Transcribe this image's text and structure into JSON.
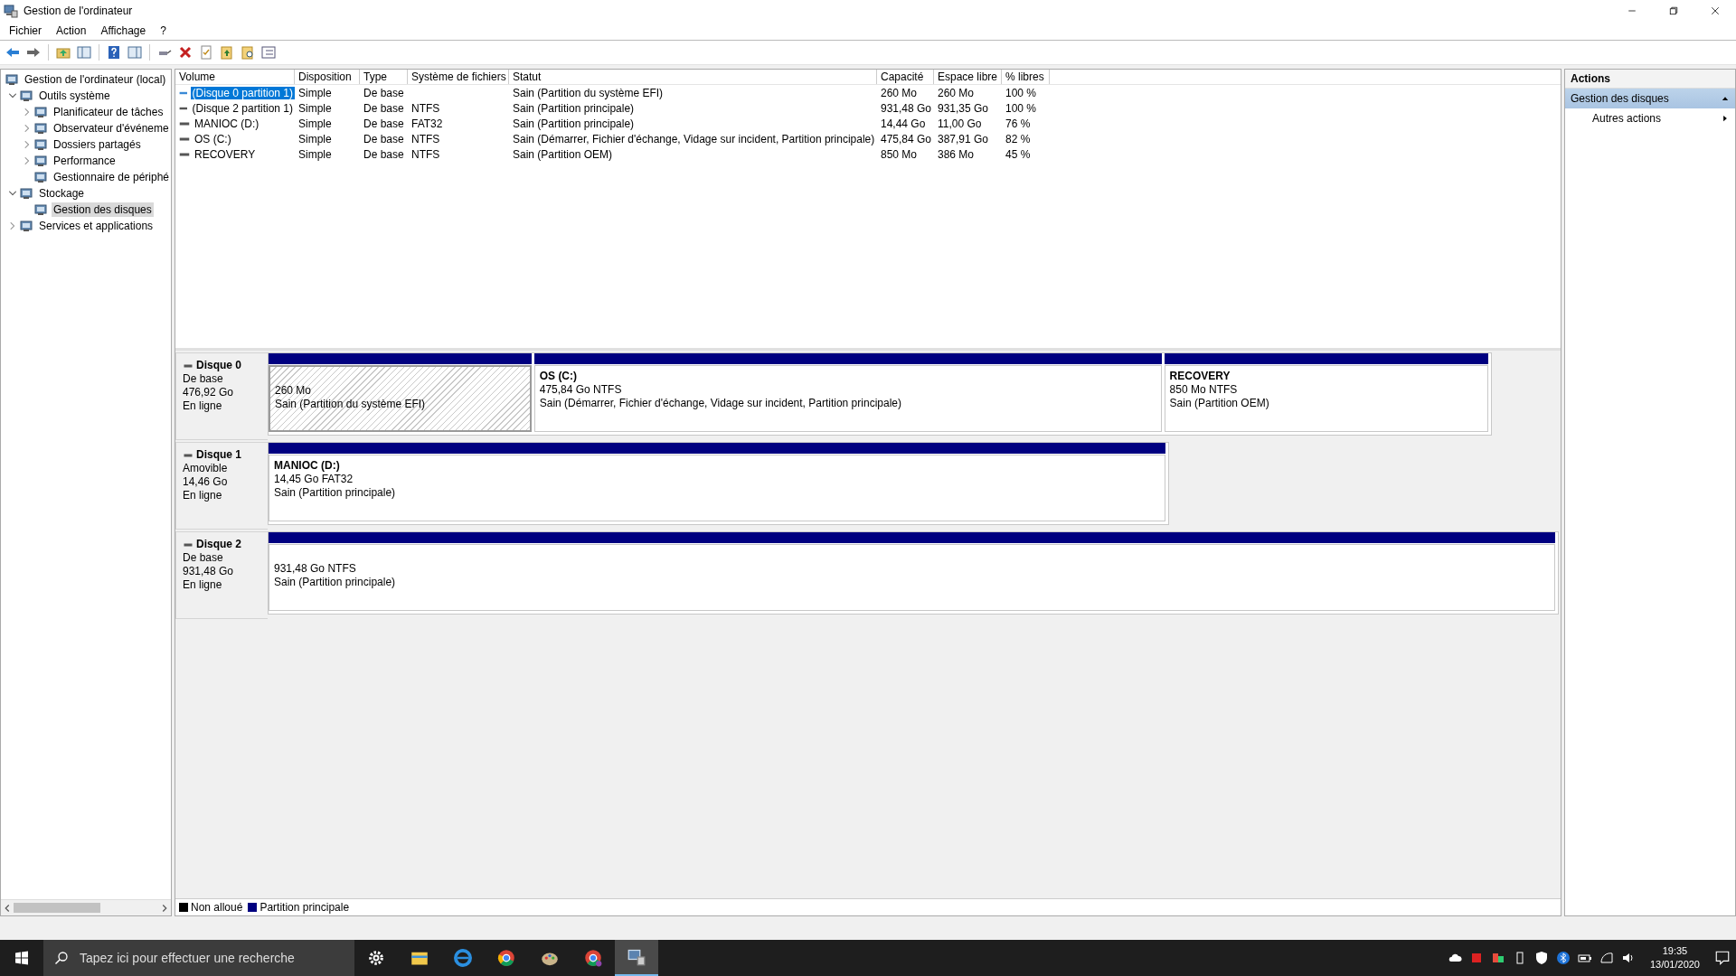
{
  "window": {
    "title": "Gestion de l'ordinateur"
  },
  "menu": [
    "Fichier",
    "Action",
    "Affichage",
    "?"
  ],
  "tree": [
    {
      "label": "Gestion de l'ordinateur (local)",
      "selected": false,
      "children": [
        {
          "label": "Outils système",
          "expanded": true,
          "selected": false,
          "children": [
            {
              "label": "Planificateur de tâches",
              "expanded": false,
              "selected": false
            },
            {
              "label": "Observateur d'événeme",
              "expanded": false,
              "selected": false
            },
            {
              "label": "Dossiers partagés",
              "expanded": false,
              "selected": false
            },
            {
              "label": "Performance",
              "expanded": false,
              "selected": false
            },
            {
              "label": "Gestionnaire de périphé",
              "selected": false
            }
          ]
        },
        {
          "label": "Stockage",
          "expanded": true,
          "selected": false,
          "children": [
            {
              "label": "Gestion des disques",
              "selected": true
            }
          ]
        },
        {
          "label": "Services et applications",
          "expanded": false,
          "selected": false
        }
      ]
    }
  ],
  "table": {
    "columns": [
      "Volume",
      "Disposition",
      "Type",
      "Système de fichiers",
      "Statut",
      "Capacité",
      "Espace libre",
      "% libres"
    ],
    "rows": [
      {
        "selected": true,
        "cells": [
          "(Disque 0 partition 1)",
          "Simple",
          "De base",
          "",
          "Sain (Partition du système EFI)",
          "260 Mo",
          "260 Mo",
          "100 %"
        ]
      },
      {
        "selected": false,
        "cells": [
          "(Disque 2 partition 1)",
          "Simple",
          "De base",
          "NTFS",
          "Sain (Partition principale)",
          "931,48 Go",
          "931,35 Go",
          "100 %"
        ]
      },
      {
        "selected": false,
        "cells": [
          "MANIOC (D:)",
          "Simple",
          "De base",
          "FAT32",
          "Sain (Partition principale)",
          "14,44 Go",
          "11,00 Go",
          "76 %"
        ]
      },
      {
        "selected": false,
        "cells": [
          "OS (C:)",
          "Simple",
          "De base",
          "NTFS",
          "Sain (Démarrer, Fichier d'échange, Vidage sur incident, Partition principale)",
          "475,84 Go",
          "387,91 Go",
          "82 %"
        ]
      },
      {
        "selected": false,
        "cells": [
          "RECOVERY",
          "Simple",
          "De base",
          "NTFS",
          "Sain (Partition OEM)",
          "850 Mo",
          "386 Mo",
          "45 %"
        ]
      }
    ]
  },
  "disks": [
    {
      "name": "Disque 0",
      "type": "De base",
      "size": "476,92 Go",
      "state": "En ligne",
      "partitions": [
        {
          "selected": true,
          "size": "260 Mo",
          "status": "Sain (Partition du système EFI)"
        },
        {
          "selected": false,
          "name": "OS  (C:)",
          "size": "475,84 Go NTFS",
          "status": "Sain (Démarrer, Fichier d'échange, Vidage sur incident, Partition principale)"
        },
        {
          "selected": false,
          "name": "RECOVERY",
          "size": "850 Mo NTFS",
          "status": "Sain (Partition OEM)"
        }
      ]
    },
    {
      "name": "Disque 1",
      "type": "Amovible",
      "size": "14,46 Go",
      "state": "En ligne",
      "partitions": [
        {
          "selected": false,
          "name": "MANIOC  (D:)",
          "size": "14,45 Go FAT32",
          "status": "Sain (Partition principale)"
        }
      ]
    },
    {
      "name": "Disque 2",
      "type": "De base",
      "size": "931,48 Go",
      "state": "En ligne",
      "partitions": [
        {
          "selected": false,
          "size": "931,48 Go NTFS",
          "status": "Sain (Partition principale)"
        }
      ]
    }
  ],
  "legend": [
    {
      "label": "Non alloué",
      "color": "#000000"
    },
    {
      "label": "Partition principale",
      "color": "#000080"
    }
  ],
  "actions": {
    "title": "Actions",
    "section": "Gestion des disques",
    "expanded": true,
    "items": [
      "Autres actions"
    ]
  },
  "taskbar": {
    "search_placeholder": "Tapez ici pour effectuer une recherche",
    "time": "19:35",
    "date": "13/01/2020"
  }
}
